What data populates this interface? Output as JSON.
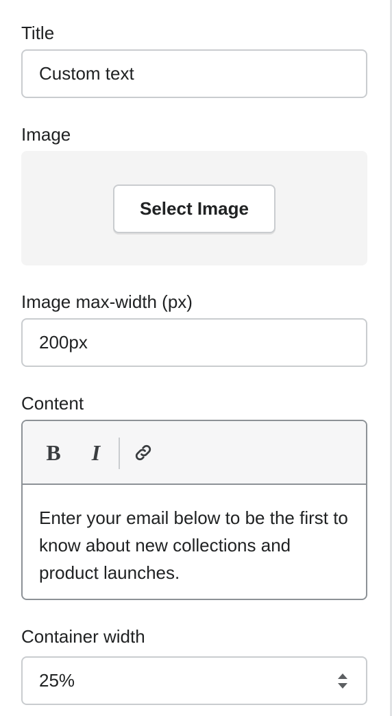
{
  "title_field": {
    "label": "Title",
    "value": "Custom text"
  },
  "image_field": {
    "label": "Image",
    "button_label": "Select Image"
  },
  "image_max_width": {
    "label": "Image max-width (px)",
    "value": "200px"
  },
  "content_field": {
    "label": "Content",
    "toolbar": {
      "bold_label": "B",
      "italic_label": "I",
      "link_icon": "link-icon"
    },
    "text": "Enter your email below to be the first to know about new collections and product launches."
  },
  "container_width": {
    "label": "Container width",
    "selected": "25%"
  },
  "colors": {
    "border": "#c9cccf",
    "editor_border": "#8c9196",
    "image_box_bg": "#f4f4f4",
    "toolbar_bg": "#f6f6f7",
    "text": "#202223"
  }
}
